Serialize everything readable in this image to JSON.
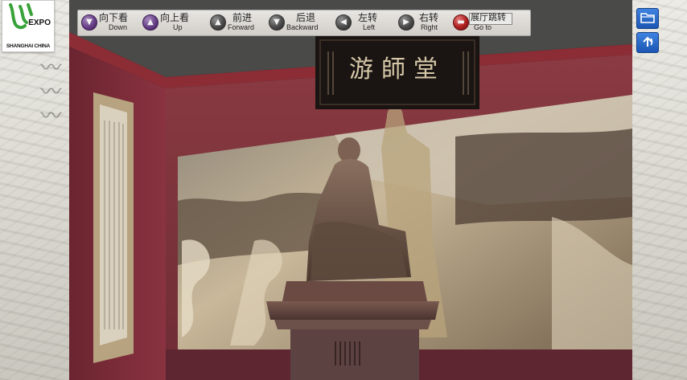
{
  "logo": {
    "expo_text": "EXPO",
    "location_text": "SHANGHAI CHINA",
    "brand_color": "#3aa23a"
  },
  "toolbar": {
    "buttons": [
      {
        "icon": "look-down-icon",
        "cn": "向下看",
        "en": "Down"
      },
      {
        "icon": "look-up-icon",
        "cn": "向上看",
        "en": "Up"
      },
      {
        "icon": "forward-icon",
        "cn": "前进",
        "en": "Forward"
      },
      {
        "icon": "backward-icon",
        "cn": "后退",
        "en": "Backward"
      },
      {
        "icon": "turn-left-icon",
        "cn": "左转",
        "en": "Left"
      },
      {
        "icon": "turn-right-icon",
        "cn": "右转",
        "en": "Right"
      },
      {
        "icon": "goto-icon",
        "cn": "展厅跳转",
        "en": "Go to"
      }
    ]
  },
  "right_tools": [
    {
      "icon": "open-folder-icon"
    },
    {
      "icon": "refresh-back-icon"
    }
  ],
  "scene": {
    "plaque_text": "游師堂",
    "accent_colors": {
      "wall": "#7a2a35",
      "ceiling": "#4a4a48",
      "floor": "#2a1a18"
    }
  }
}
